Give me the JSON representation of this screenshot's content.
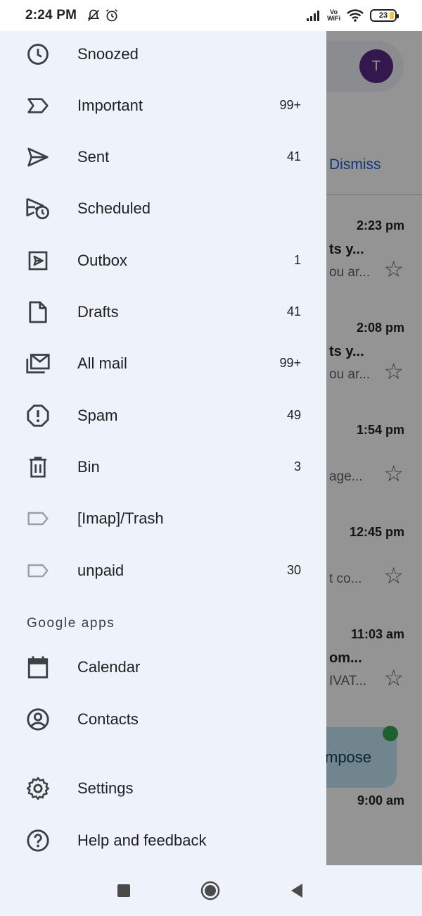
{
  "status_bar": {
    "time": "2:24 PM",
    "vowifi_line1": "Vo",
    "vowifi_line2": "WiFi",
    "battery": "23"
  },
  "background": {
    "avatar_letter": "T",
    "dismiss_label": "Dismiss",
    "compose_label": "mpose",
    "emails": [
      {
        "time": "2:23 pm",
        "sender": "ts y...",
        "snippet": "ou ar..."
      },
      {
        "time": "2:08 pm",
        "sender": "ts y...",
        "snippet": "ou ar..."
      },
      {
        "time": "1:54 pm",
        "sender": "",
        "snippet": "age..."
      },
      {
        "time": "12:45 pm",
        "sender": "",
        "snippet": "t co..."
      },
      {
        "time": "11:03 am",
        "sender": "om...",
        "snippet": "IVAT..."
      },
      {
        "time": "9:00 am",
        "sender": "",
        "snippet": ""
      }
    ]
  },
  "drawer": {
    "items": [
      {
        "label": "Snoozed",
        "count": "",
        "icon": "clock-icon"
      },
      {
        "label": "Important",
        "count": "99+",
        "icon": "important-icon"
      },
      {
        "label": "Sent",
        "count": "41",
        "icon": "send-icon"
      },
      {
        "label": "Scheduled",
        "count": "",
        "icon": "scheduled-send-icon"
      },
      {
        "label": "Outbox",
        "count": "1",
        "icon": "outbox-icon"
      },
      {
        "label": "Drafts",
        "count": "41",
        "icon": "draft-icon"
      },
      {
        "label": "All mail",
        "count": "99+",
        "icon": "all-mail-icon"
      },
      {
        "label": "Spam",
        "count": "49",
        "icon": "spam-icon"
      },
      {
        "label": "Bin",
        "count": "3",
        "icon": "trash-icon"
      },
      {
        "label": "[Imap]/Trash",
        "count": "",
        "icon": "label-icon"
      },
      {
        "label": "unpaid",
        "count": "30",
        "icon": "label-icon"
      }
    ],
    "google_apps_header": "Google apps",
    "apps": [
      {
        "label": "Calendar",
        "icon": "calendar-icon"
      },
      {
        "label": "Contacts",
        "icon": "contacts-icon"
      }
    ],
    "settings": {
      "label": "Settings",
      "icon": "gear-icon"
    },
    "help": {
      "label": "Help and feedback",
      "icon": "help-icon"
    }
  }
}
